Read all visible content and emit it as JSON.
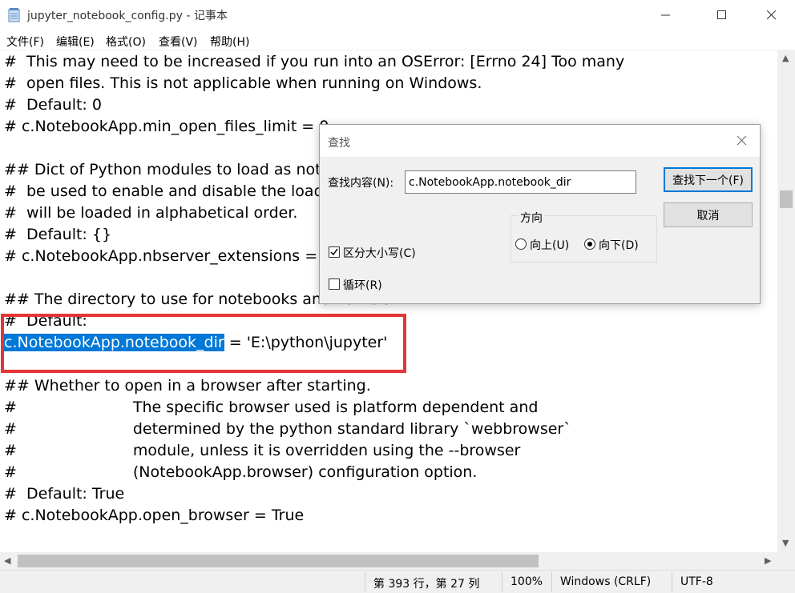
{
  "window": {
    "title": "jupyter_notebook_config.py - 记事本"
  },
  "menu": [
    "文件(F)",
    "编辑(E)",
    "格式(O)",
    "查看(V)",
    "帮助(H)"
  ],
  "editor": {
    "lines": [
      "#  This may need to be increased if you run into an OSError: [Errno 24] Too many",
      "#  open files. This is not applicable when running on Windows.",
      "#  Default: 0",
      "# c.NotebookApp.min_open_files_limit = 0",
      "",
      "## Dict of Python modules to load as not",
      "#  be used to enable and disable the load",
      "#  will be loaded in alphabetical order.",
      "#  Default: {}",
      "# c.NotebookApp.nbserver_extensions = ",
      "",
      "## The directory to use for notebooks and kernels.",
      "#  Default: ",
      "",
      "",
      "## Whether to open in a browser after starting.",
      "#                        The specific browser used is platform dependent and",
      "#                        determined by the python standard library `webbrowser`",
      "#                        module, unless it is overridden using the --browser",
      "#                        (NotebookApp.browser) configuration option.",
      "#  Default: True",
      "# c.NotebookApp.open_browser = True"
    ],
    "selected_line": {
      "selected_text": "c.NotebookApp.notebook_dir",
      "rest_text": " = 'E:\\python\\jupyter'"
    }
  },
  "status": {
    "position": "第 393 行，第 27 列",
    "zoom": "100%",
    "line_ending": "Windows (CRLF)",
    "encoding": "UTF-8"
  },
  "find_dialog": {
    "title": "查找",
    "find_label": "查找内容(N):",
    "find_value": "c.NotebookApp.notebook_dir",
    "find_next_label": "查找下一个(F)",
    "cancel_label": "取消",
    "direction_label": "方向",
    "up_label": "向上(U)",
    "down_label": "向下(D)",
    "direction_selected": "down",
    "match_case_label": "区分大小写(C)",
    "match_case_checked": true,
    "wrap_label": "循环(R)",
    "wrap_checked": false
  },
  "colors": {
    "selection": "#0078d7",
    "highlight_box": "#e53535"
  }
}
